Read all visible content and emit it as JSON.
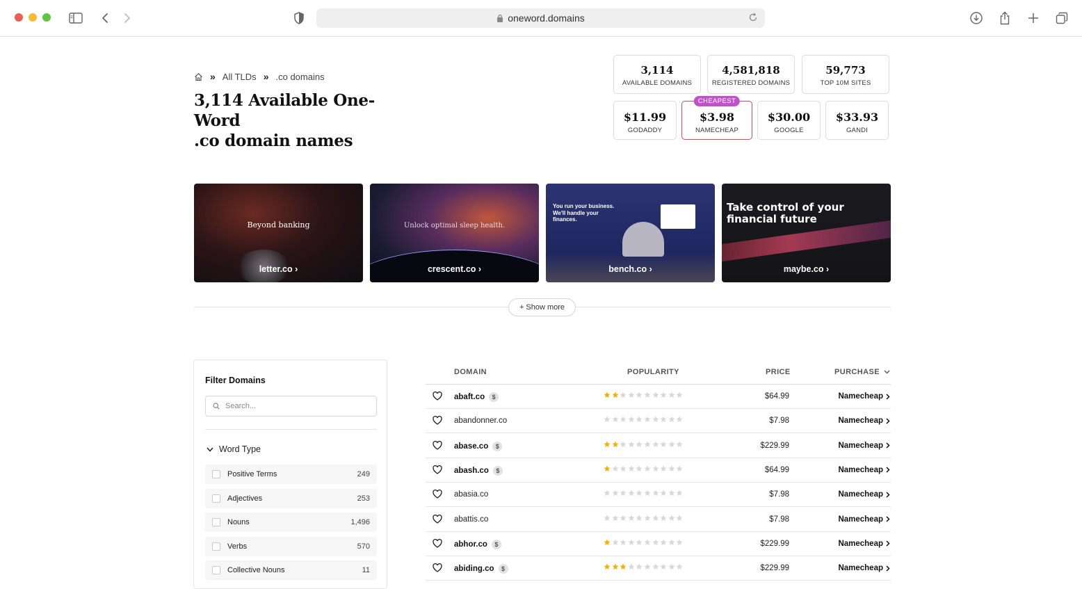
{
  "browser": {
    "url": "oneword.domains",
    "colors": {
      "close": "#ee5e57",
      "minimize": "#f5bd2f",
      "zoom": "#5fc43f"
    }
  },
  "breadcrumb": {
    "home_icon": "home-icon",
    "items": [
      "All TLDs",
      ".co domains"
    ],
    "separator": "»"
  },
  "page": {
    "title_line1": "3,114 Available One-Word",
    "title_line2": ".co domain names"
  },
  "stats": [
    {
      "value": "3,114",
      "label": "AVAILABLE DOMAINS"
    },
    {
      "value": "4,581,818",
      "label": "REGISTERED DOMAINS"
    },
    {
      "value": "59,773",
      "label": "TOP 10M SITES"
    }
  ],
  "prices": [
    {
      "value": "$11.99",
      "label": "GODADDY"
    },
    {
      "value": "$3.98",
      "label": "NAMECHEAP",
      "badge": "CHEAPEST"
    },
    {
      "value": "$30.00",
      "label": "GOOGLE"
    },
    {
      "value": "$33.93",
      "label": "GANDI"
    }
  ],
  "showcase": [
    {
      "caption": "letter.co ›",
      "heading": "Beyond banking"
    },
    {
      "caption": "crescent.co ›",
      "heading": "Unlock optimal sleep health."
    },
    {
      "caption": "bench.co ›",
      "heading": "You run your business. We'll handle your finances."
    },
    {
      "caption": "maybe.co ›",
      "heading": "Take control of your financial future"
    }
  ],
  "show_more": "+ Show more",
  "filter": {
    "title": "Filter Domains",
    "search_placeholder": "Search...",
    "section": "Word Type",
    "items": [
      {
        "label": "Positive Terms",
        "count": "249"
      },
      {
        "label": "Adjectives",
        "count": "253"
      },
      {
        "label": "Nouns",
        "count": "1,496"
      },
      {
        "label": "Verbs",
        "count": "570"
      },
      {
        "label": "Collective Nouns",
        "count": "11"
      }
    ]
  },
  "table": {
    "headers": {
      "domain": "DOMAIN",
      "popularity": "POPULARITY",
      "price": "PRICE",
      "purchase": "PURCHASE"
    },
    "star_colors": {
      "filled": "#f0b400",
      "empty": "#d8d8d8"
    },
    "rows": [
      {
        "domain": "abaft.co",
        "premium": true,
        "stars": 2,
        "price": "$64.99",
        "registrar": "Namecheap"
      },
      {
        "domain": "abandonner.co",
        "premium": false,
        "stars": 0,
        "price": "$7.98",
        "registrar": "Namecheap"
      },
      {
        "domain": "abase.co",
        "premium": true,
        "stars": 2,
        "price": "$229.99",
        "registrar": "Namecheap"
      },
      {
        "domain": "abash.co",
        "premium": true,
        "stars": 1,
        "price": "$64.99",
        "registrar": "Namecheap"
      },
      {
        "domain": "abasia.co",
        "premium": false,
        "stars": 0,
        "price": "$7.98",
        "registrar": "Namecheap"
      },
      {
        "domain": "abattis.co",
        "premium": false,
        "stars": 0,
        "price": "$7.98",
        "registrar": "Namecheap"
      },
      {
        "domain": "abhor.co",
        "premium": true,
        "stars": 1,
        "price": "$229.99",
        "registrar": "Namecheap"
      },
      {
        "domain": "abiding.co",
        "premium": true,
        "stars": 3,
        "price": "$229.99",
        "registrar": "Namecheap"
      }
    ]
  }
}
